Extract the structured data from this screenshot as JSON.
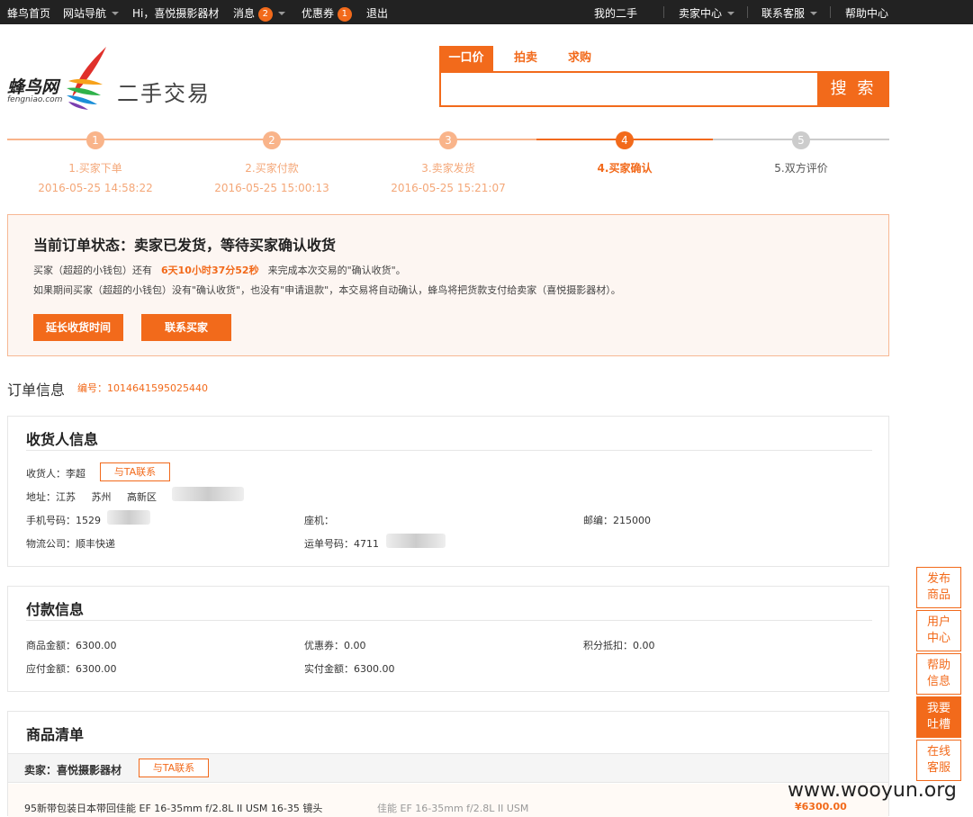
{
  "topbar": {
    "home": "蜂鸟首页",
    "site_nav": "网站导航",
    "greeting": "Hi，喜悦摄影器材",
    "messages": "消息",
    "messages_count": "2",
    "coupons": "优惠券",
    "coupons_count": "1",
    "logout": "退出",
    "my_secondhand": "我的二手",
    "seller_center": "卖家中心",
    "contact_service": "联系客服",
    "help_center": "帮助中心"
  },
  "logo": {
    "name": "蜂鸟网",
    "domain": "fengniao.com",
    "section": "二手交易"
  },
  "search": {
    "tabs": [
      "一口价",
      "拍卖",
      "求购"
    ],
    "active_tab": "一口价",
    "value": "",
    "button": "搜 索"
  },
  "steps": [
    {
      "num": "1",
      "label": "1.买家下单",
      "time": "2016-05-25 14:58:22",
      "state": "done"
    },
    {
      "num": "2",
      "label": "2.买家付款",
      "time": "2016-05-25 15:00:13",
      "state": "done"
    },
    {
      "num": "3",
      "label": "3.卖家发货",
      "time": "2016-05-25 15:21:07",
      "state": "done"
    },
    {
      "num": "4",
      "label": "4.买家确认",
      "time": "",
      "state": "current"
    },
    {
      "num": "5",
      "label": "5.双方评价",
      "time": "",
      "state": "todo"
    }
  ],
  "status": {
    "title": "当前订单状态：卖家已发货，等待买家确认收货",
    "line1_prefix": "买家（超超的小钱包）还有",
    "countdown": "6天10小时37分52秒",
    "line1_suffix": "来完成本次交易的\"确认收货\"。",
    "line2": "如果期间买家（超超的小钱包）没有\"确认收货\"，也没有\"申请退款\"，本交易将自动确认，蜂鸟将把货款支付给卖家（喜悦摄影器材）。",
    "extend_button": "延长收货时间",
    "contact_buyer_button": "联系买家"
  },
  "order": {
    "title": "订单信息",
    "number_label": "编号：",
    "number": "1014641595025440"
  },
  "receiver": {
    "title": "收货人信息",
    "name_label": "收货人：",
    "name": "李超",
    "contact_button": "与TA联系",
    "address_label": "地址：",
    "province": "江苏",
    "city": "苏州",
    "district": "高新区",
    "phone_label": "手机号码：",
    "phone": "1529",
    "landline_label": "座机：",
    "landline": "",
    "zip_label": "邮编：",
    "zip": "215000",
    "courier_label": "物流公司：",
    "courier": "顺丰快递",
    "waybill_label": "运单号码：",
    "waybill": "4711"
  },
  "payment": {
    "title": "付款信息",
    "goods_amount_label": "商品金额：",
    "goods_amount": "6300.00",
    "coupon_label": "优惠券：",
    "coupon": "0.00",
    "points_label": "积分抵扣：",
    "points": "0.00",
    "payable_label": "应付金额：",
    "payable": "6300.00",
    "paid_label": "实付金额：",
    "paid": "6300.00"
  },
  "goods": {
    "title": "商品清单",
    "seller_label": "卖家：",
    "seller": "喜悦摄影器材",
    "contact_button": "与TA联系",
    "items": [
      {
        "name": "95新带包装日本带回佳能 EF 16-35mm f/2.8L II USM 16-35 镜头",
        "model": "佳能 EF 16-35mm f/2.8L II USM",
        "price": "¥6300.00"
      }
    ]
  },
  "sidebar": [
    {
      "line1": "发布",
      "line2": "商品",
      "active": false
    },
    {
      "line1": "用户",
      "line2": "中心",
      "active": false
    },
    {
      "line1": "帮助",
      "line2": "信息",
      "active": false
    },
    {
      "line1": "我要",
      "line2": "吐槽",
      "active": true
    },
    {
      "line1": "在线",
      "line2": "客服",
      "active": false
    }
  ],
  "watermark": "www.wooyun.org",
  "colors": {
    "accent": "#f26a1b",
    "topbar": "#222222",
    "light_accent": "#f4a778"
  }
}
